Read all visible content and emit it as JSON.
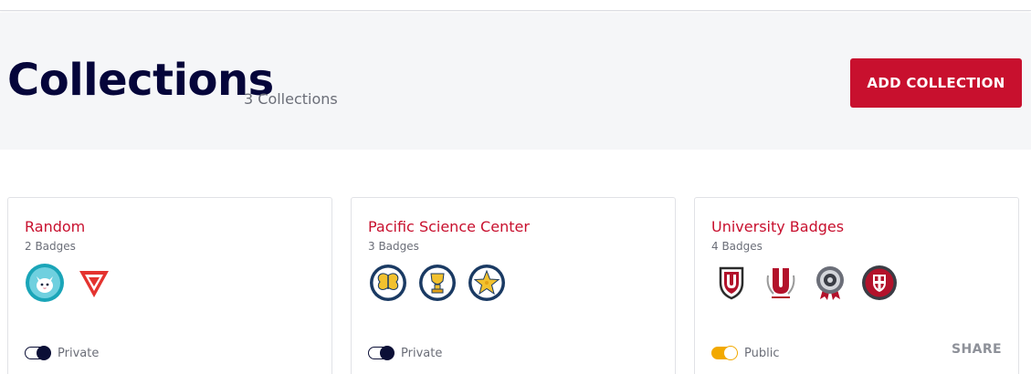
{
  "header": {
    "title": "Collections",
    "count": "3 Collections",
    "add_button": "ADD COLLECTION"
  },
  "colors": {
    "brand_red": "#c8102e",
    "title_navy": "#05053a",
    "toggle_on": "#f2a900"
  },
  "collections": [
    {
      "title": "Random",
      "count": "2 Badges",
      "privacy": "Private",
      "badges": [
        "cat-badge-icon",
        "triangle-badge-icon"
      ]
    },
    {
      "title": "Pacific Science Center",
      "count": "3 Badges",
      "privacy": "Private",
      "badges": [
        "butterfly-badge-icon",
        "trophy-badge-icon",
        "starfish-badge-icon"
      ]
    },
    {
      "title": "University Badges",
      "count": "4 Badges",
      "privacy": "Public",
      "share": "SHARE",
      "badges": [
        "university-shield-badge-icon",
        "university-laurel-badge-icon",
        "medal-ribbon-badge-icon",
        "crest-badge-icon"
      ]
    }
  ]
}
